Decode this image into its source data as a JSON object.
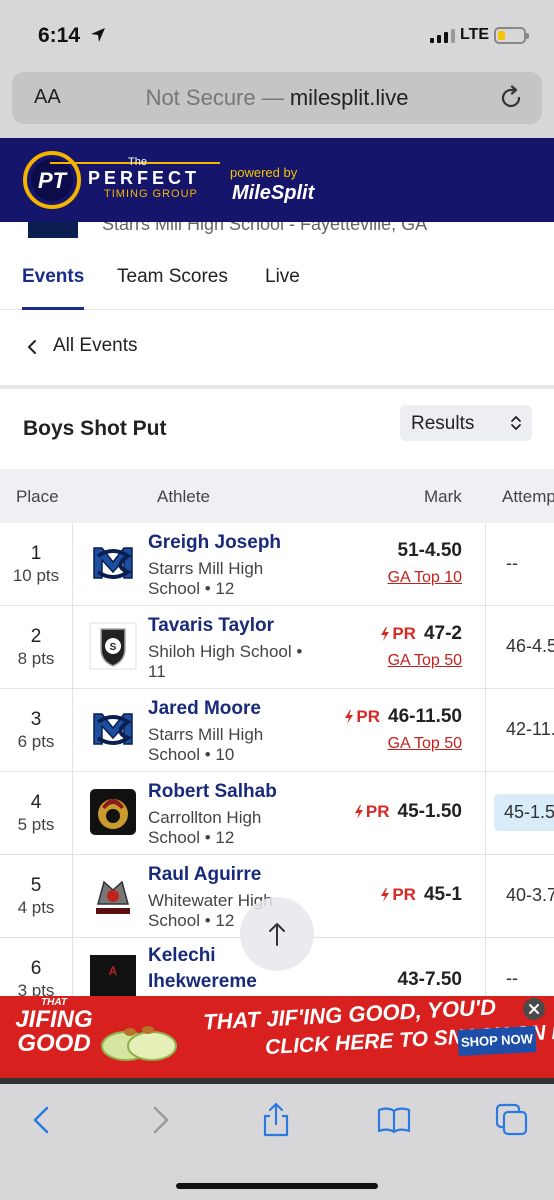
{
  "status": {
    "time": "6:14",
    "network": "LTE",
    "battery_percent": 15
  },
  "browser": {
    "aa_label": "AA",
    "url_prefix": "Not Secure — ",
    "url_domain": "milesplit.live"
  },
  "banner": {
    "the": "The",
    "perfect": "PERFECT",
    "timing": "TIMING GROUP",
    "powered_by": "powered by",
    "milesplit": "MileSplit"
  },
  "meet_header": {
    "subtitle": "Starrs Mill High School - Fayetteville, GA"
  },
  "tabs": [
    {
      "label": "Events",
      "active": true
    },
    {
      "label": "Team Scores",
      "active": false
    },
    {
      "label": "Live",
      "active": false
    }
  ],
  "back_link": "All Events",
  "event": {
    "title": "Boys Shot Put",
    "view_select": "Results"
  },
  "table": {
    "headers": {
      "place": "Place",
      "athlete": "Athlete",
      "mark": "Mark",
      "attempts": "Attemp"
    },
    "rows": [
      {
        "place": "1",
        "points": "10 pts",
        "name": "Greigh Joseph",
        "school": "Starrs Mill High School • 12",
        "mark": "51-4.50",
        "pr": "",
        "badge": "GA Top 10",
        "attempt": "--",
        "attempt_highlight": false,
        "logo": "starrs-mill-logo"
      },
      {
        "place": "2",
        "points": "8 pts",
        "name": "Tavaris Taylor",
        "school": "Shiloh High School • 11",
        "mark": "47-2",
        "pr": "PR",
        "badge": "GA Top 50",
        "attempt": "46-4.5",
        "attempt_highlight": false,
        "logo": "shiloh-generals-logo"
      },
      {
        "place": "3",
        "points": "6 pts",
        "name": "Jared Moore",
        "school": "Starrs Mill High School • 10",
        "mark": "46-11.50",
        "pr": "PR",
        "badge": "GA Top 50",
        "attempt": "42-11.",
        "attempt_highlight": false,
        "logo": "starrs-mill-logo"
      },
      {
        "place": "4",
        "points": "5 pts",
        "name": "Robert Salhab",
        "school": "Carrollton High School • 12",
        "mark": "45-1.50",
        "pr": "PR",
        "badge": "",
        "attempt": "45-1.5",
        "attempt_highlight": true,
        "logo": "carrollton-trojans-logo"
      },
      {
        "place": "5",
        "points": "4 pts",
        "name": "Raul Aguirre",
        "school": "Whitewater High School • 12",
        "mark": "45-1",
        "pr": "PR",
        "badge": "",
        "attempt": "40-3.7",
        "attempt_highlight": false,
        "logo": "whitewater-logo"
      },
      {
        "place": "6",
        "points": "3 pts",
        "name": "Kelechi Ihekwereme",
        "school": "",
        "mark": "43-7.50",
        "pr": "",
        "badge": "",
        "attempt": "--",
        "attempt_highlight": false,
        "logo": "school-logo-dark"
      }
    ]
  },
  "ad": {
    "brand_line1": "THAT",
    "brand_line2": "JIFING",
    "brand_line3": "GOOD",
    "headline1": "THAT JIF'ING GOOD, YOU'D",
    "headline2": "CLICK HERE TO SNACK ON IT.",
    "cta": "SHOP NOW"
  },
  "colors": {
    "brand_navy": "#15156b",
    "tab_active": "#1a2d8c",
    "link_red": "#c0221e",
    "pr_red": "#d72a23",
    "ad_red": "#d8211f"
  }
}
